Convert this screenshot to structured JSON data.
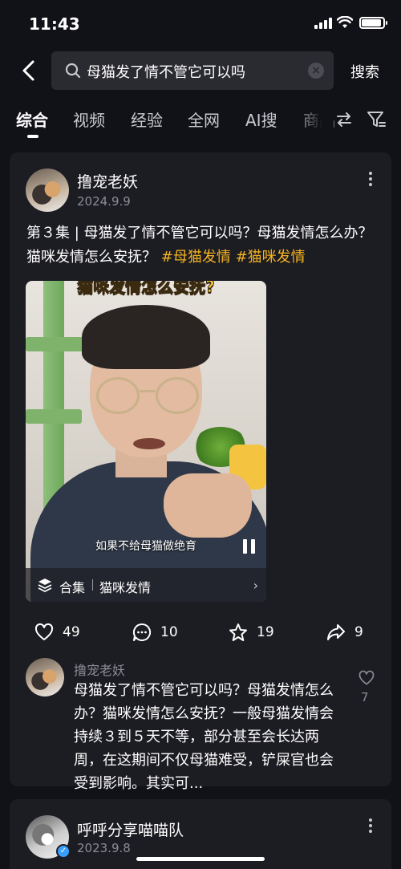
{
  "status_bar": {
    "time": "11:43"
  },
  "search": {
    "query": "母猫发了情不管它可以吗",
    "submit_label": "搜索"
  },
  "tabs": [
    {
      "label": "综合",
      "active": true
    },
    {
      "label": "视频"
    },
    {
      "label": "经验"
    },
    {
      "label": "全网"
    },
    {
      "label": "AI搜"
    },
    {
      "label": "商品"
    }
  ],
  "post": {
    "author": "撸宠老妖",
    "date": "2024.9.9",
    "title": "第３集 | 母猫发了情不管它可以吗？母猫发情怎么办？猫咪发情怎么安抚？",
    "hashtags": [
      "#母猫发情",
      "#猫咪发情"
    ],
    "video": {
      "overlay_title": "猫咪发情怎么安抚?",
      "subtitle": "如果不给母猫做绝育",
      "collection_label": "合集",
      "collection_name": "猫咪发情"
    },
    "actions": {
      "likes": "49",
      "comments": "10",
      "favorites": "19",
      "shares": "9"
    },
    "comment": {
      "author": "撸宠老妖",
      "text": "母猫发了情不管它可以吗？母猫发情怎么办？猫咪发情怎么安抚？一般母猫发情会持续３到５天不等，部分甚至会长达两周，在这期间不仅母猫难受，铲屎官也会受到影响。其实可...",
      "likes": "7"
    }
  },
  "post2": {
    "author": "呼呼分享喵喵队",
    "date": "2023.9.8"
  },
  "colors": {
    "background": "#111118",
    "card": "#1c1c23",
    "hashtag": "#f5b321"
  }
}
